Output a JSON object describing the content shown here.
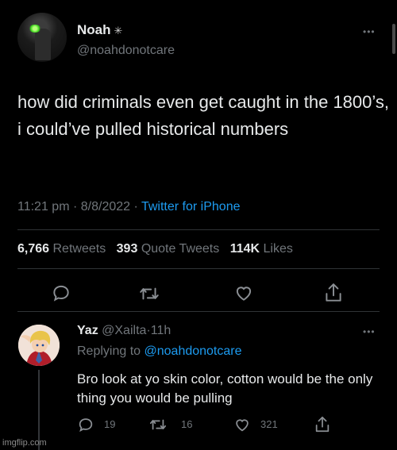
{
  "tweet": {
    "author_name": "Noah",
    "author_badge": "✳",
    "handle": "@noahdonotcare",
    "text": "how did criminals even get caught in the 1800’s, i could’ve pulled historical numbers",
    "time": "11:21 pm",
    "sep1": "·",
    "date": "8/8/2022",
    "sep2": "·",
    "client": "Twitter for iPhone",
    "retweets_count": "6,766",
    "retweets_label": "Retweets",
    "quotes_count": "393",
    "quotes_label": "Quote Tweets",
    "likes_count": "114K",
    "likes_label": "Likes",
    "more": "•••"
  },
  "reply": {
    "author_name": "Yaz",
    "handle": "@Xailta",
    "sep": "·",
    "age": "11h",
    "replying_prefix": "Replying to",
    "replying_handle": "@noahdonotcare",
    "text": "Bro look at yo skin color, cotton would be the only thing you would be pulling",
    "replies": "19",
    "retweets": "16",
    "likes": "321",
    "more": "•••"
  },
  "icons": [
    "reply-icon",
    "retweet-icon",
    "like-icon",
    "share-icon",
    "more-icon"
  ],
  "colors": {
    "background": "#000000",
    "text": "#e7e9ea",
    "muted": "#71767b",
    "accent": "#1d9bf0"
  },
  "watermark": "imgflip.com"
}
